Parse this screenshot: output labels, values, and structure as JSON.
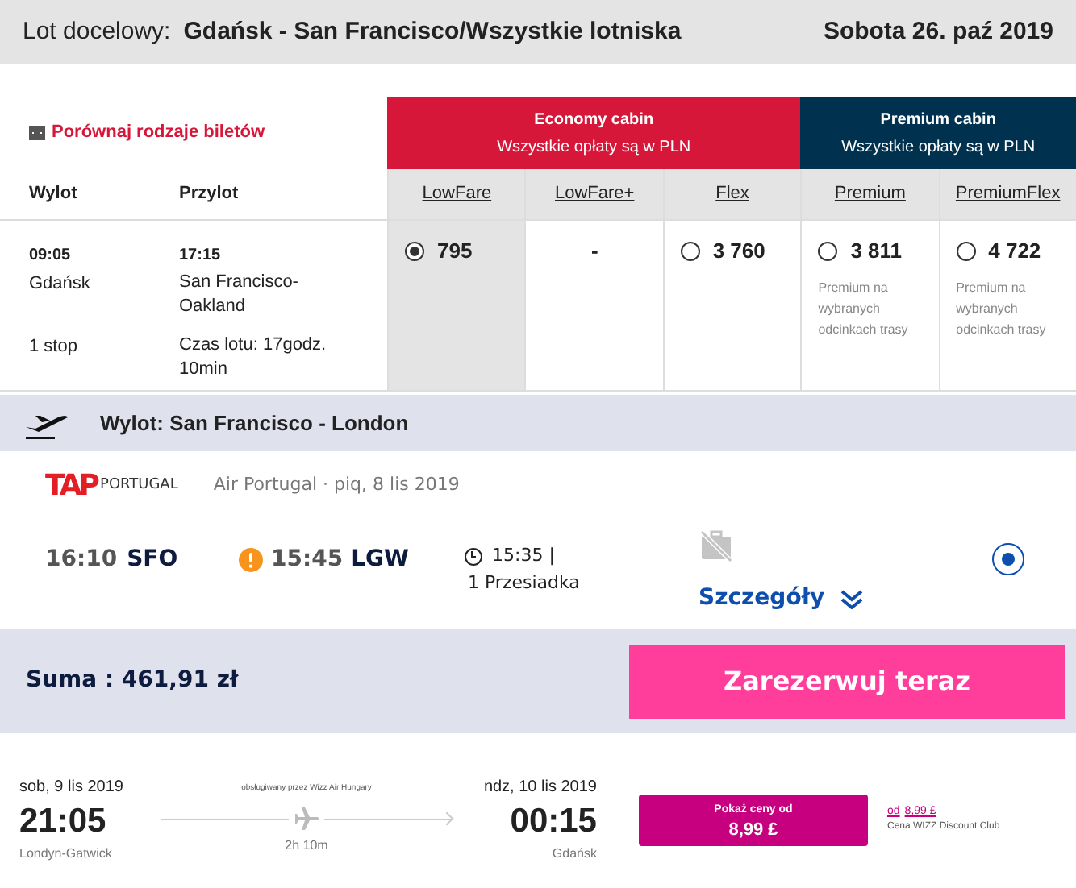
{
  "header": {
    "label": "Lot docelowy:",
    "route": "Gdańsk - San Francisco/Wszystkie lotniska",
    "date": "Sobota 26. paź 2019"
  },
  "compare_link": "Porównaj rodzaje biletów",
  "cabins": [
    {
      "name": "Economy cabin",
      "note": "Wszystkie opłaty są w PLN",
      "color": "#d6173a"
    },
    {
      "name": "Premium cabin",
      "note": "Wszystkie opłaty są w PLN",
      "color": "#00324f"
    }
  ],
  "columns": {
    "departure": "Wylot",
    "arrival": "Przylot"
  },
  "flight": {
    "dep_time": "09:05",
    "dep_city": "Gdańsk",
    "stops": "1 stop",
    "arr_time": "17:15",
    "arr_city": "San Francisco-Oakland",
    "duration": "Czas lotu: 17godz. 10min"
  },
  "fares": [
    {
      "name": "LowFare",
      "kind": "radio",
      "price": "795",
      "selected": true
    },
    {
      "name": "LowFare+",
      "kind": "dash",
      "price": "-"
    },
    {
      "name": "Flex",
      "kind": "radio",
      "price": "3 760",
      "selected": false
    },
    {
      "name": "Premium",
      "kind": "radio",
      "price": "3 811",
      "selected": false,
      "note": "Premium na wybranych odcinkach trasy"
    },
    {
      "name": "PremiumFlex",
      "kind": "radio",
      "price": "4 722",
      "selected": false,
      "note": "Premium na wybranych odcinkach trasy"
    }
  ],
  "leg": {
    "title": "Wylot: San Francisco - London",
    "airline_logo": "TAP",
    "airline_logo_sub": "PORTUGAL",
    "airline": "Air Portugal · piq, 8 lis 2019",
    "dep_time": "16:10",
    "dep_code": "SFO",
    "arr_time": "15:45",
    "arr_code": "LGW",
    "duration": "15:35 |",
    "stops": "1 Przesiadka",
    "details": "Szczegóły",
    "selected": true
  },
  "total": {
    "label": "Suma : 461,91 zł",
    "button": "Zarezerwuj teraz"
  },
  "offer": {
    "dep_date": "sob, 9 lis 2019",
    "dep_time": "21:05",
    "dep_city": "Londyn-Gatwick",
    "operator": "obsługiwany przez Wizz Air Hungary",
    "duration": "2h 10m",
    "arr_date": "ndz, 10 lis 2019",
    "arr_time": "00:15",
    "arr_city": "Gdańsk",
    "button_top": "Pokaż ceny od",
    "button_price": "8,99 £",
    "club_prefix": "od",
    "club_price": "8,99 £",
    "club_label": "Cena WIZZ Discount Club"
  }
}
